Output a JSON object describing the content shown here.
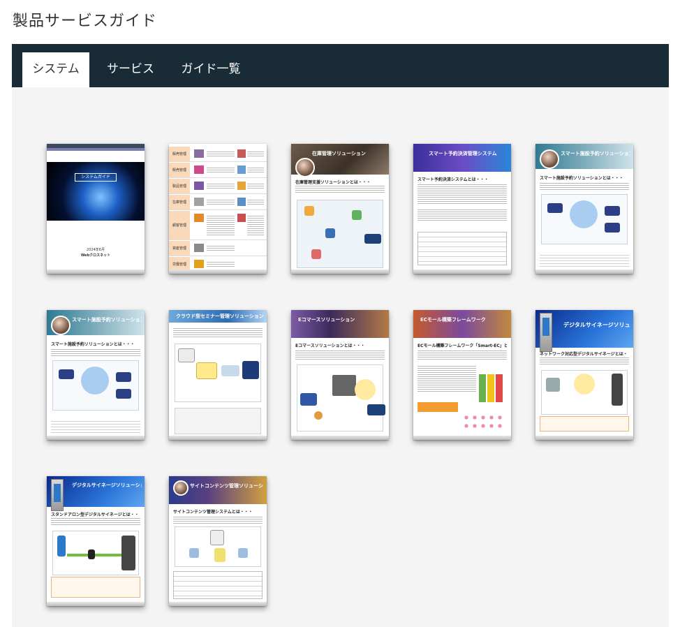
{
  "page": {
    "title": "製品サービスガイド"
  },
  "tabs": [
    {
      "label": "システム",
      "active": true
    },
    {
      "label": "サービス",
      "active": false
    },
    {
      "label": "ガイド一覧",
      "active": false
    }
  ],
  "books": [
    {
      "cover_label": "システムガイド",
      "date": "2024年6月",
      "company": "Webクロスネット"
    },
    {
      "rows": [
        "販売管理",
        "販売管理",
        "製品管理",
        "在庫管理",
        "顧客管理",
        "資産管理",
        "労働管理"
      ]
    },
    {
      "title": "在庫管理ソリューション",
      "heading": "在庫管理支援ソリューションとは・・・"
    },
    {
      "title": "スマート予約決済管理システム",
      "heading": "スマート予約決済システムとは・・・"
    },
    {
      "title": "スマート施設予約ソリューション",
      "heading": "スマート施設予約ソリューションとは・・・"
    },
    {
      "title": "スマート施設予約ソリューション",
      "heading": "スマート施設予約ソリューションとは・・・"
    },
    {
      "title": "クラウド型セミナー管理ソリューション",
      "heading": ""
    },
    {
      "title": "Eコマースソリューション",
      "heading": "Eコマースソリューションとは・・・"
    },
    {
      "title": "ECモール構築フレームワーク",
      "heading": "ECモール構築フレームワーク「Smart-EC」とは・・・"
    },
    {
      "title": "デジタルサイネージソリューション",
      "heading": "ネットワーク対応型デジタルサイネージとは・・・"
    },
    {
      "title": "デジタルサイネージソリューション",
      "heading": "スタンドアロン型デジタルサイネージとは・・・"
    },
    {
      "title": "サイトコンテンツ管理ソリューション",
      "heading": "サイトコンテンツ管理システムとは・・・"
    }
  ]
}
